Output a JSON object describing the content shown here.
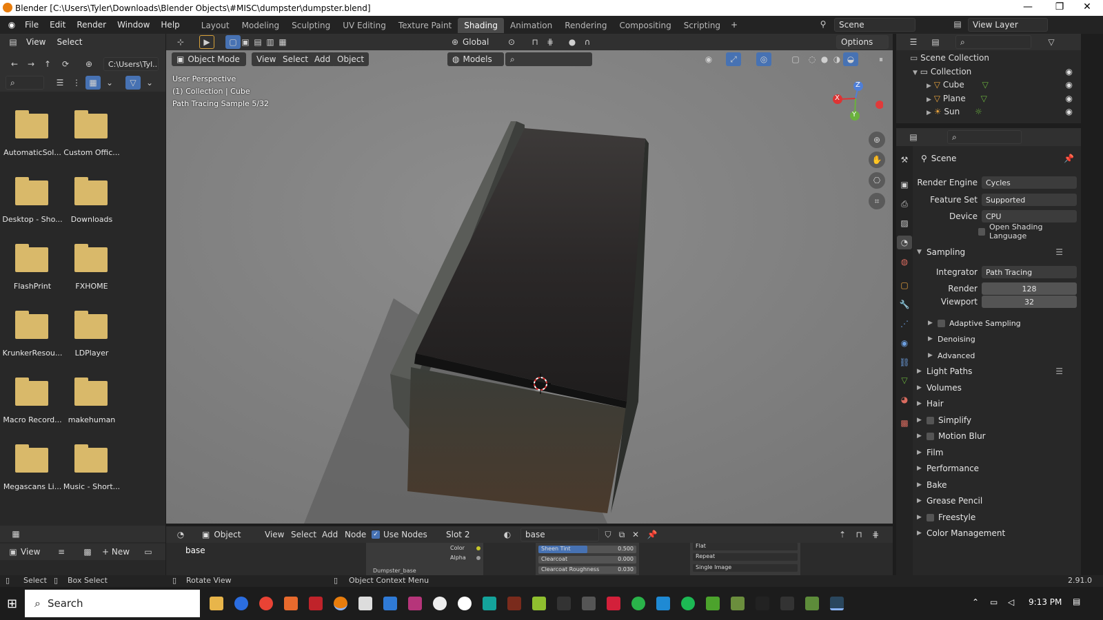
{
  "window": {
    "title": "Blender [C:\\Users\\Tyler\\Downloads\\Blender Objects\\#MISC\\dumpster\\dumpster.blend]",
    "min": "—",
    "max": "❐",
    "close": "✕"
  },
  "menu": [
    "File",
    "Edit",
    "Render",
    "Window",
    "Help"
  ],
  "workspaces": [
    "Layout",
    "Modeling",
    "Sculpting",
    "UV Editing",
    "Texture Paint",
    "Shading",
    "Animation",
    "Rendering",
    "Compositing",
    "Scripting"
  ],
  "active_workspace": "Shading",
  "scene": {
    "name": "Scene",
    "view_layer": "View Layer"
  },
  "filebrowser": {
    "menu": [
      "View",
      "Select"
    ],
    "path": "C:\\Users\\Tyl...",
    "items": [
      "AutomaticSol...",
      "Custom Offic...",
      "Desktop - Sho...",
      "Downloads",
      "FlashPrint",
      "FXHOME",
      "KrunkerResou...",
      "LDPlayer",
      "Macro Record...",
      "makehuman",
      "Megascans Li...",
      "Music - Short..."
    ],
    "bottom_view": "View",
    "bottom_new": "New"
  },
  "viewport": {
    "transform": "Global",
    "options": "Options",
    "mode": "Object Mode",
    "menu": [
      "View",
      "Select",
      "Add",
      "Object"
    ],
    "models": "Models",
    "overlay": [
      "User Perspective",
      "(1) Collection | Cube",
      "Path Tracing Sample 5/32"
    ],
    "gizmo": {
      "x": "X",
      "y": "Y",
      "z": "Z"
    }
  },
  "outliner": {
    "root": "Scene Collection",
    "collection": "Collection",
    "items": [
      "Cube",
      "Plane",
      "Sun"
    ]
  },
  "properties": {
    "context": "Scene",
    "render_engine_label": "Render Engine",
    "render_engine": "Cycles",
    "feature_set_label": "Feature Set",
    "feature_set": "Supported",
    "device_label": "Device",
    "device": "CPU",
    "osl": "Open Shading Language",
    "sampling": "Sampling",
    "integrator_label": "Integrator",
    "integrator": "Path Tracing",
    "render_label": "Render",
    "render": "128",
    "viewport_label": "Viewport",
    "viewport": "32",
    "sub": [
      "Adaptive Sampling",
      "Denoising",
      "Advanced"
    ],
    "sections": [
      "Light Paths",
      "Volumes",
      "Hair",
      "Simplify",
      "Motion Blur",
      "Film",
      "Performance",
      "Bake",
      "Grease Pencil",
      "Freestyle",
      "Color Management"
    ]
  },
  "node_editor": {
    "object": "Object",
    "menu": [
      "View",
      "Select",
      "Add",
      "Node"
    ],
    "use_nodes": "Use Nodes",
    "slot": "Slot 2",
    "material": "base",
    "tree_label": "base",
    "sockets": [
      "Color",
      "Alpha"
    ],
    "node_name": "Dumpster_base",
    "params": [
      {
        "label": "Sheen Tint",
        "value": "0.500"
      },
      {
        "label": "Clearcoat",
        "value": "0.000"
      },
      {
        "label": "Clearcoat Roughness",
        "value": "0.030"
      }
    ],
    "tex_opts": [
      "Flat",
      "Repeat",
      "Single Image"
    ]
  },
  "statusbar": {
    "select": "Select",
    "box_select": "Box Select",
    "rotate": "Rotate View",
    "context": "Object Context Menu",
    "version": "2.91.0"
  },
  "taskbar": {
    "search": "Search",
    "time": "9:13 PM"
  }
}
